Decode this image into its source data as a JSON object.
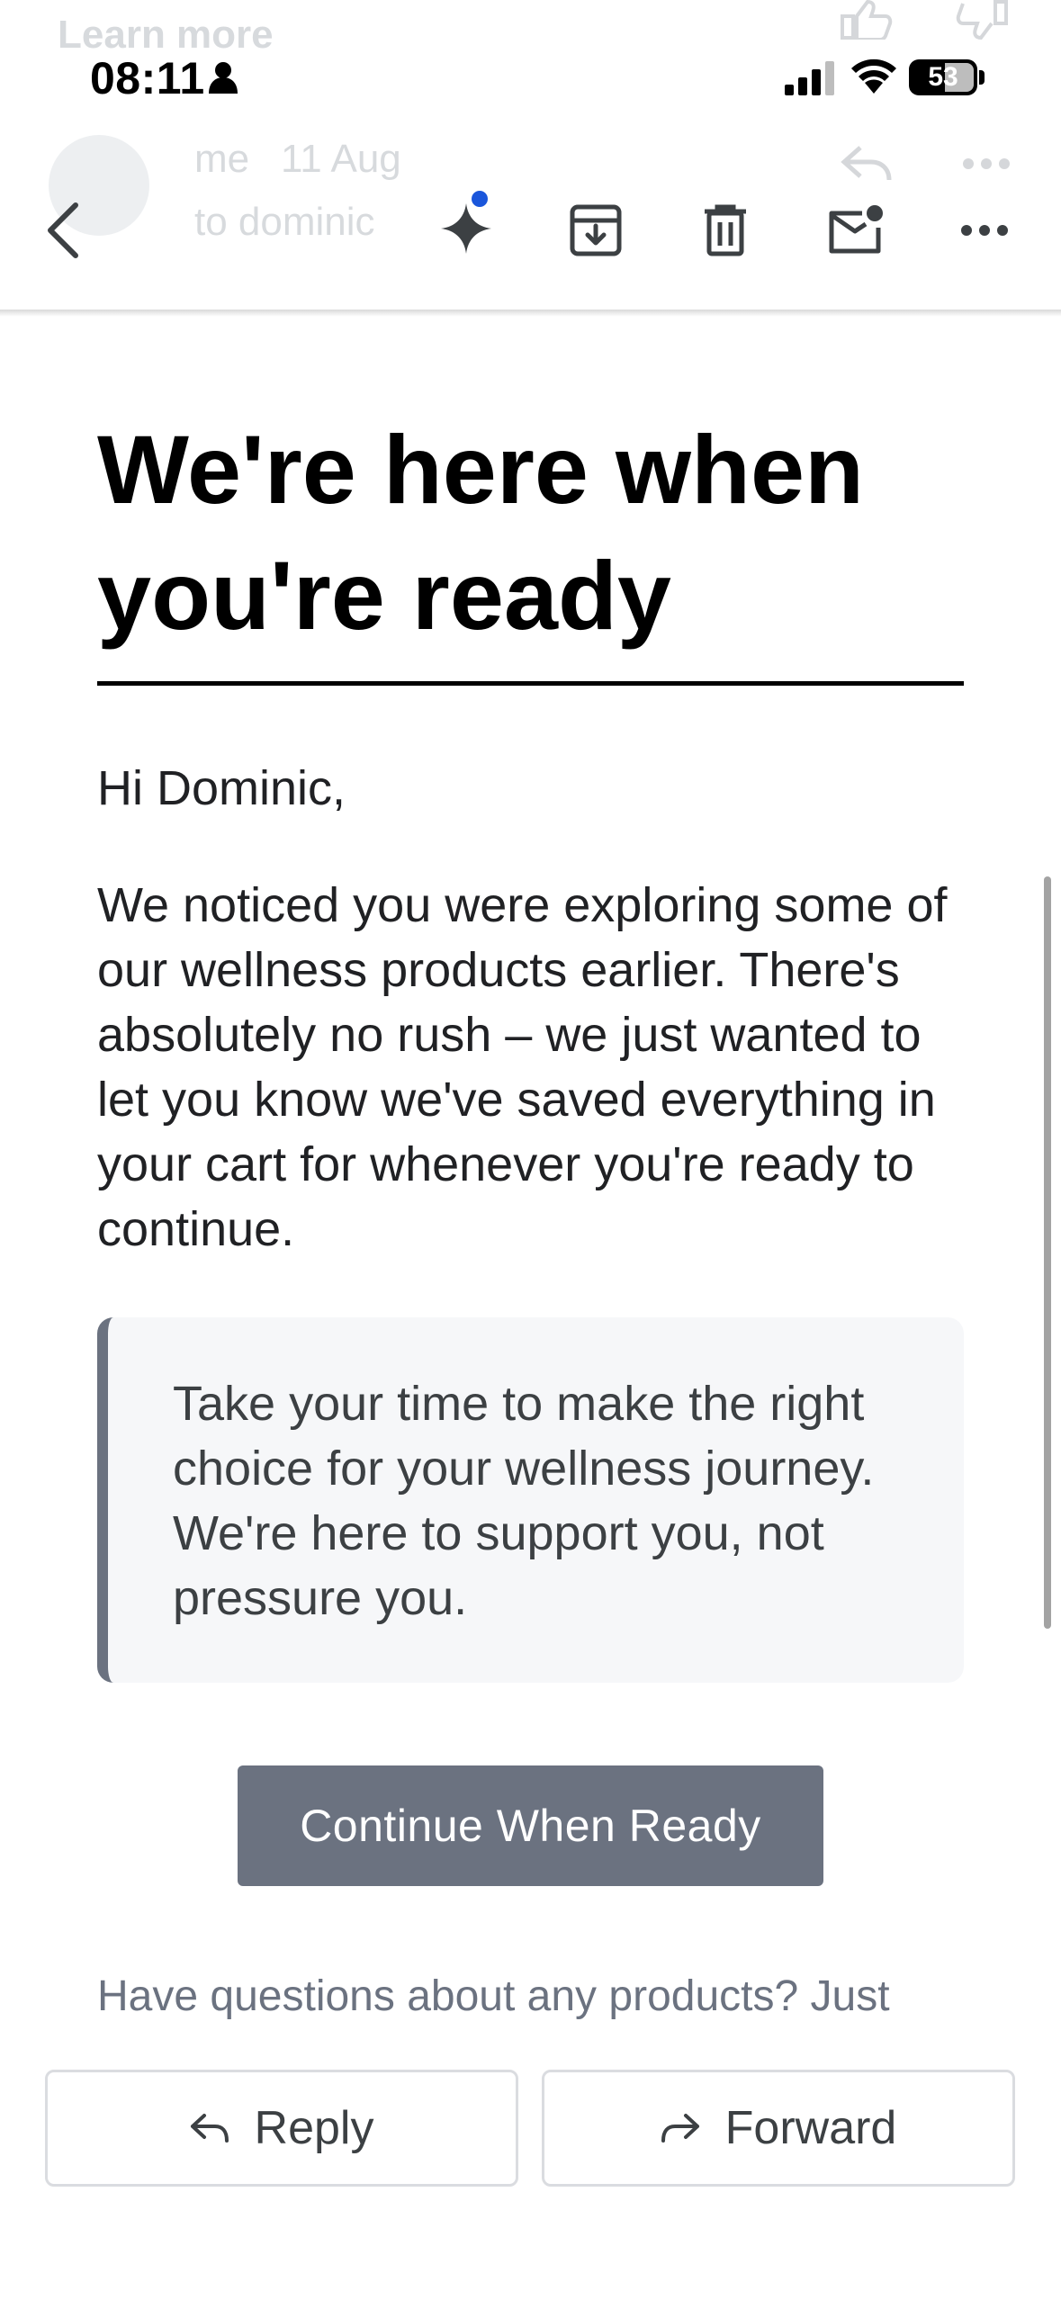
{
  "background_ghost": {
    "learn_more": "Learn more",
    "sender": "me",
    "date": "11 Aug",
    "recipient": "to dominic"
  },
  "status_bar": {
    "time": "08:11",
    "battery_percent": "53",
    "battery_level": 0.53,
    "icons": [
      "person-icon",
      "cellular-signal-icon",
      "wifi-icon",
      "battery-icon"
    ]
  },
  "toolbar": {
    "icons": [
      "back-arrow-icon",
      "gemini-sparkle-icon",
      "archive-icon",
      "trash-icon",
      "mark-unread-icon",
      "more-horizontal-icon"
    ],
    "accent_color": "#1a56db"
  },
  "email": {
    "headline": "We're here when you're ready",
    "greeting": "Hi Dominic,",
    "body": "We noticed you were exploring some of our wellness products earlier. There's absolutely no rush – we just wanted to let you know we've saved everything in your cart for whenever you're ready to continue.",
    "quote": "Take your time to make the right choice for your wellness journey. We're here to support you, not pressure you.",
    "cta_label": "Continue When Ready",
    "cta_color": "#6b7280",
    "footer": "Have questions about any products? Just reply to this email – we'd love to help you."
  },
  "actions": {
    "reply_label": "Reply",
    "forward_label": "Forward"
  }
}
